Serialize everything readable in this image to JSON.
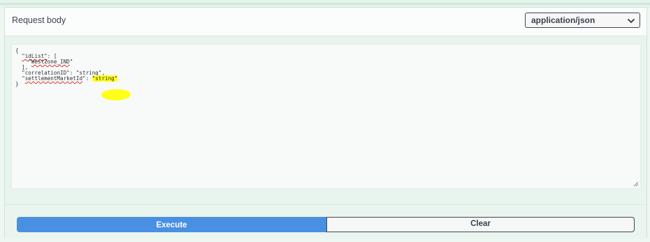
{
  "request_body": {
    "title": "Request body",
    "content_type": {
      "selected": "application/json",
      "icon": "chevron-down-icon"
    },
    "editor": {
      "lines": [
        "{",
        "  \"idList\": [",
        "    \"WestZone_IND\"",
        "  ],",
        "  \"correlationID\": \"string\",",
        "  \"settlementMarketId\": \"string\"",
        "}"
      ],
      "highlight_color": "#ffff1a",
      "spellcheck_color": "#e03030"
    }
  },
  "actions": {
    "execute_label": "Execute",
    "clear_label": "Clear",
    "execute_color": "#4990e2"
  }
}
